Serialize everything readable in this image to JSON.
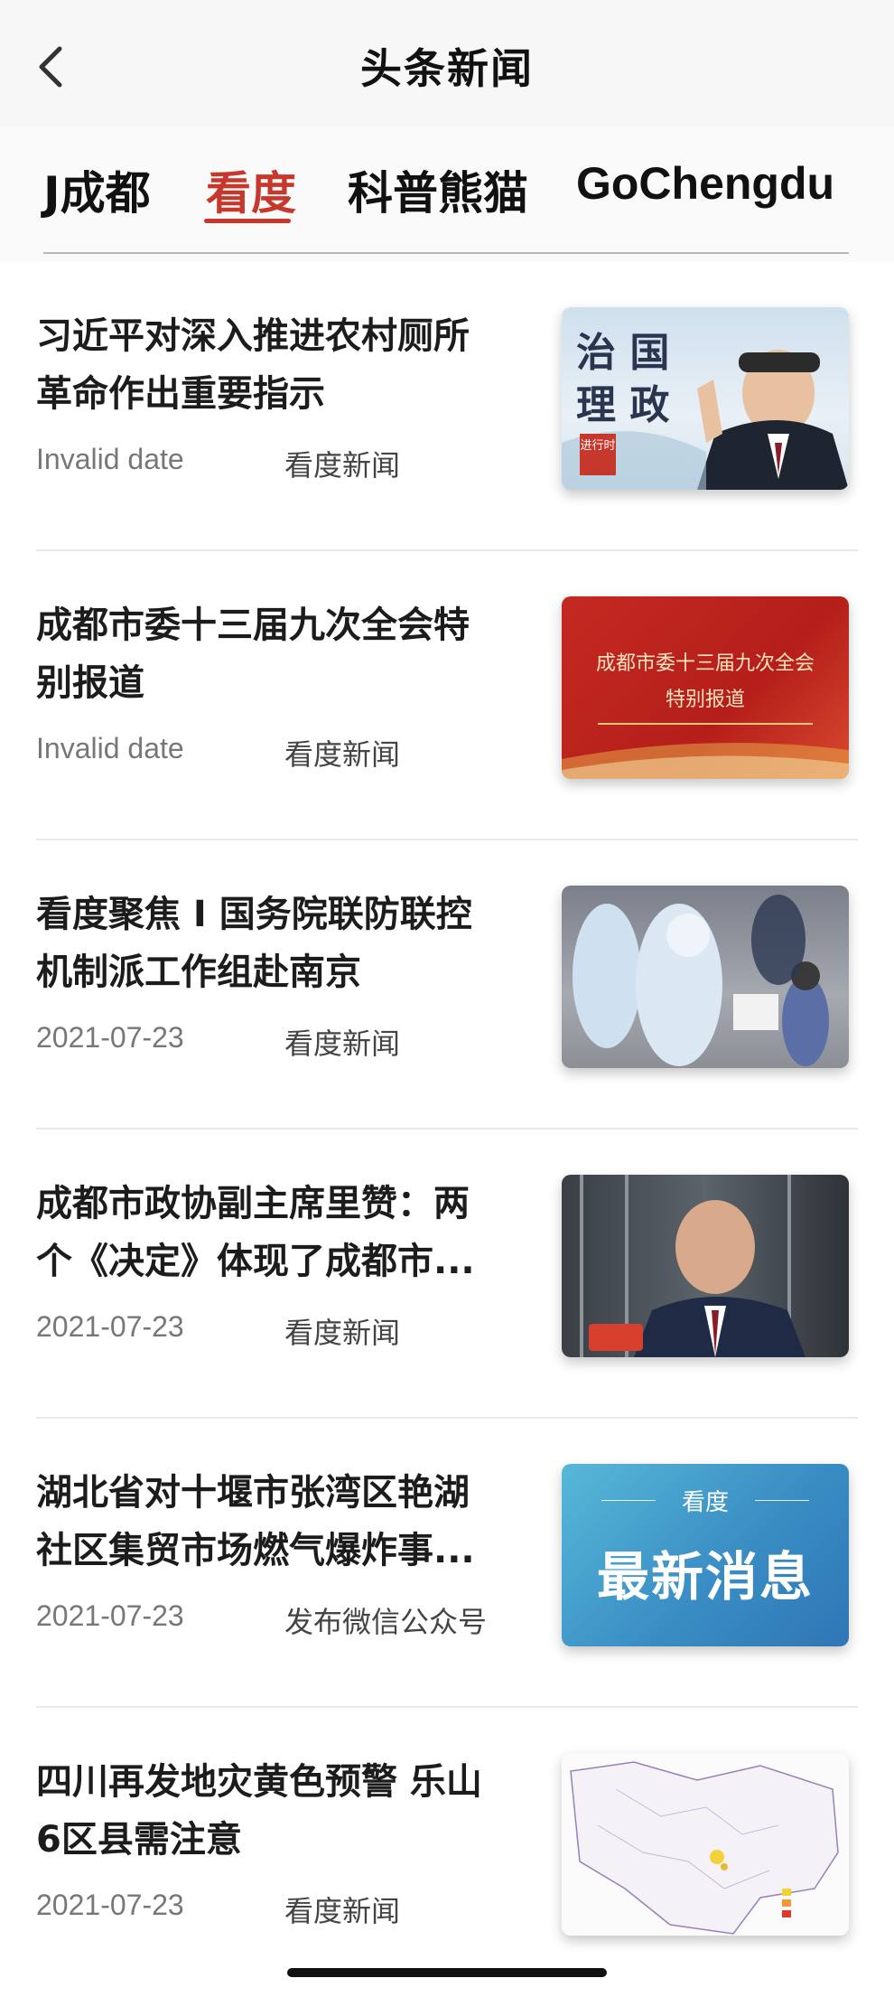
{
  "header": {
    "title": "头条新闻",
    "back_icon": "chevron-left-icon"
  },
  "tabs": [
    {
      "label": "J成都",
      "active": false
    },
    {
      "label": "看度",
      "active": true
    },
    {
      "label": "科普熊猫",
      "active": false
    },
    {
      "label": "GoChengdu",
      "active": false
    }
  ],
  "accent_color": "#c6372c",
  "news": [
    {
      "title": "习近平对深入推进农村厕所革命作出重要指示",
      "date": "Invalid date",
      "source": "看度新闻",
      "thumb": {
        "lines": [
          "治 国",
          "理 政"
        ],
        "badge": "进行时"
      }
    },
    {
      "title": "成都市委十三届九次全会特别报道",
      "date": "Invalid date",
      "source": "看度新闻",
      "thumb": {
        "lines": [
          "成都市委十三届九次全会",
          "特别报道"
        ]
      }
    },
    {
      "title": "看度聚焦 I 国务院联防联控机制派工作组赴南京",
      "date": "2021-07-23",
      "source": "看度新闻",
      "thumb": {}
    },
    {
      "title": "成都市政协副主席里赞：两个《决定》体现了成都市...",
      "date": "2021-07-23",
      "source": "看度新闻",
      "thumb": {}
    },
    {
      "title": "湖北省对十堰市张湾区艳湖社区集贸市场燃气爆炸事...",
      "date": "2021-07-23",
      "source": "发布微信公众号",
      "thumb": {
        "lines": [
          "看度",
          "最新消息"
        ]
      }
    },
    {
      "title": "四川再发地灾黄色预警 乐山6区县需注意",
      "date": "2021-07-23",
      "source": "看度新闻",
      "thumb": {}
    }
  ]
}
